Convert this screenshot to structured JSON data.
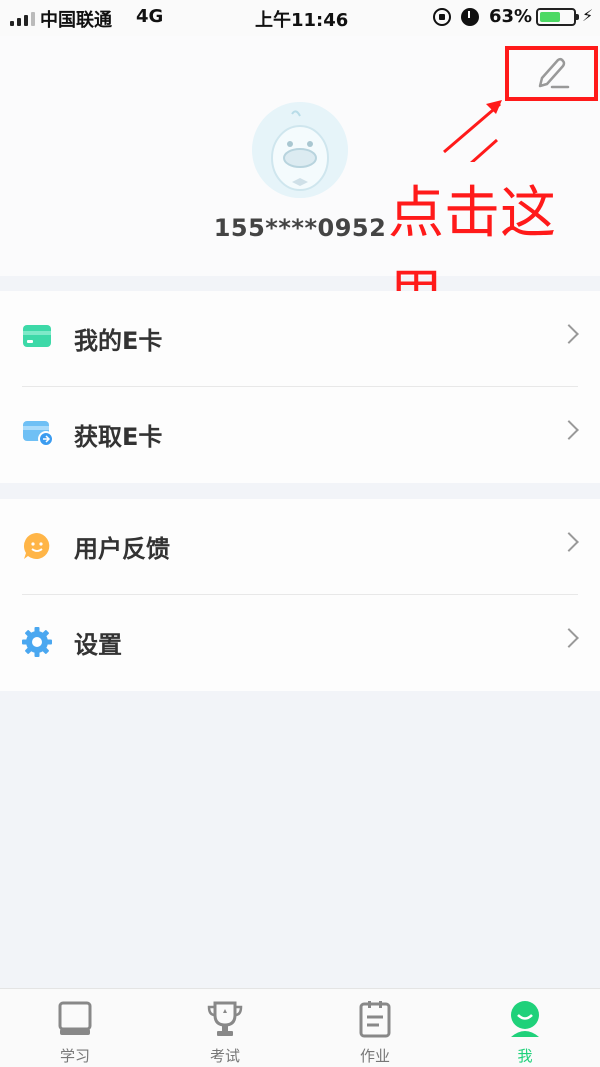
{
  "status_bar": {
    "carrier": "中国联通",
    "network": "4G",
    "time": "上午11:46",
    "battery_percent": "63%",
    "battery_level": 0.63
  },
  "profile": {
    "phone": "155****0952",
    "edit_icon": "pen-edit-icon"
  },
  "annotation": {
    "text": "点击这里",
    "color": "#ff1a1a"
  },
  "menu": {
    "group1": [
      {
        "label": "我的E卡",
        "icon": "ecard-icon"
      },
      {
        "label": "获取E卡",
        "icon": "get-ecard-icon"
      }
    ],
    "group2": [
      {
        "label": "用户反馈",
        "icon": "feedback-icon"
      },
      {
        "label": "设置",
        "icon": "settings-gear-icon"
      }
    ]
  },
  "tabs": [
    {
      "label": "学习",
      "icon": "book-icon",
      "active": false
    },
    {
      "label": "考试",
      "icon": "trophy-icon",
      "active": false
    },
    {
      "label": "作业",
      "icon": "clipboard-icon",
      "active": false
    },
    {
      "label": "我",
      "icon": "profile-face-icon",
      "active": true
    }
  ],
  "colors": {
    "accent_green": "#1fd17a",
    "annotation_red": "#ff1a1a",
    "background": "#f2f4f8"
  }
}
